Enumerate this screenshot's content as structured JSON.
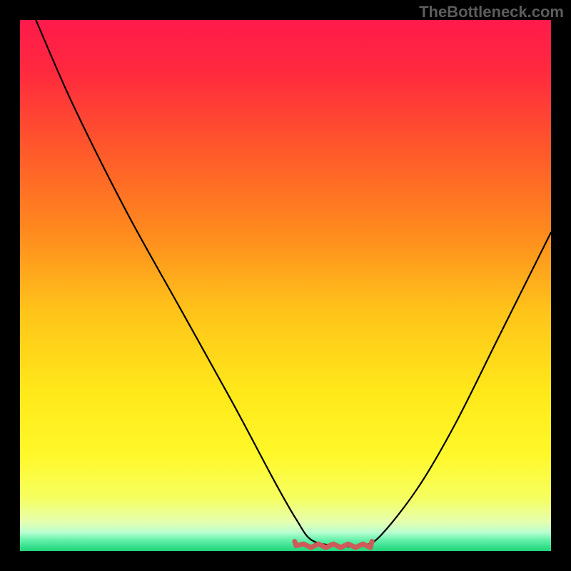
{
  "watermark": "TheBottleneck.com",
  "colors": {
    "frame": "#000000",
    "watermark_text": "#5c5c5c",
    "curve": "#000000",
    "flat_marker": "#cf5a5a",
    "gradient_stops": [
      {
        "offset": 0.0,
        "color": "#ff1a4b"
      },
      {
        "offset": 0.1,
        "color": "#ff2a3e"
      },
      {
        "offset": 0.25,
        "color": "#ff5a2a"
      },
      {
        "offset": 0.4,
        "color": "#ff8a1e"
      },
      {
        "offset": 0.55,
        "color": "#ffc41a"
      },
      {
        "offset": 0.7,
        "color": "#ffe81a"
      },
      {
        "offset": 0.82,
        "color": "#fff82a"
      },
      {
        "offset": 0.9,
        "color": "#f6ff60"
      },
      {
        "offset": 0.945,
        "color": "#e6ffb0"
      },
      {
        "offset": 0.965,
        "color": "#b8ffd0"
      },
      {
        "offset": 0.98,
        "color": "#60f0a8"
      },
      {
        "offset": 1.0,
        "color": "#1fd47a"
      }
    ]
  },
  "chart_data": {
    "type": "line",
    "title": "",
    "xlabel": "",
    "ylabel": "",
    "xlim": [
      0,
      1
    ],
    "ylim": [
      0,
      1
    ],
    "series": [
      {
        "name": "bottleneck-curve",
        "x": [
          0.03,
          0.1,
          0.2,
          0.3,
          0.4,
          0.48,
          0.52,
          0.55,
          0.6,
          0.645,
          0.68,
          0.75,
          0.82,
          0.9,
          1.0
        ],
        "y": [
          1.0,
          0.84,
          0.64,
          0.46,
          0.28,
          0.13,
          0.06,
          0.02,
          0.01,
          0.01,
          0.03,
          0.12,
          0.24,
          0.4,
          0.6
        ]
      }
    ],
    "flat_region": {
      "x_start": 0.52,
      "x_end": 0.66,
      "y": 0.01
    },
    "notes": "V-shaped black curve over vertical rainbow heat gradient; flat bottom highlighted with short red squiggle; black frame; watermark top-right."
  }
}
